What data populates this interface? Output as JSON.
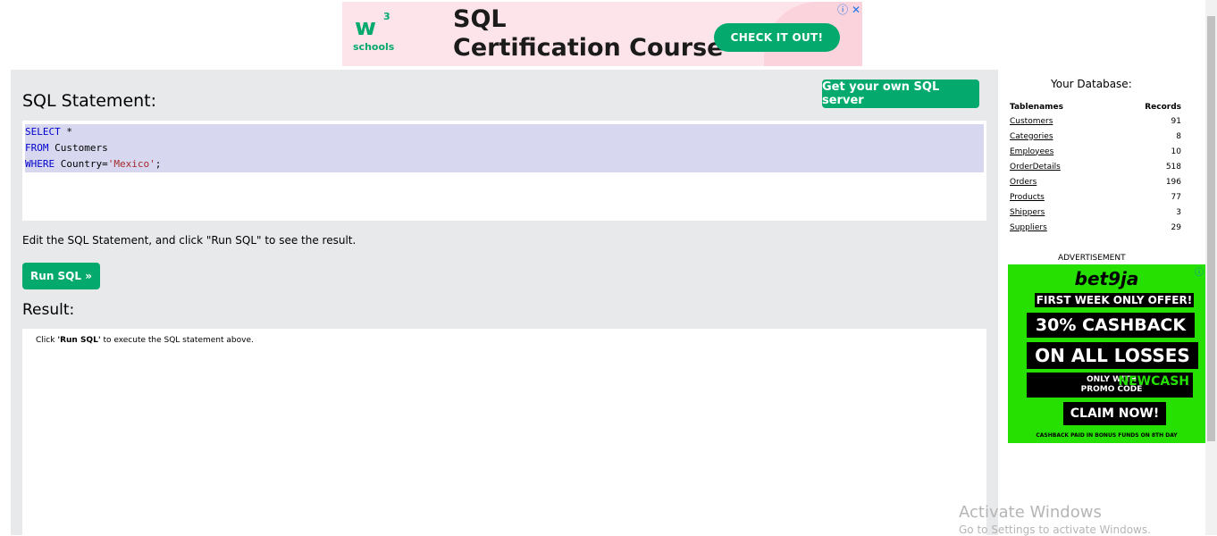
{
  "top_ad": {
    "logo_mark": "w",
    "logo_sup": "3",
    "logo_text": "schools",
    "title_line1": "SQL",
    "title_line2": "Certification Course",
    "cta": "CHECK IT OUT!",
    "icons": "ⓘ ✕"
  },
  "editor": {
    "heading": "SQL Statement:",
    "own_server_button": "Get your own SQL server",
    "code_lines": [
      {
        "kw": "SELECT",
        "rest": " *",
        "str": "",
        "tail": ""
      },
      {
        "kw": "FROM",
        "rest": " Customers",
        "str": "",
        "tail": ""
      },
      {
        "kw": "WHERE",
        "rest": " Country=",
        "str": "'Mexico'",
        "tail": ";"
      }
    ],
    "instruction": "Edit the SQL Statement, and click \"Run SQL\" to see the result.",
    "run_button": "Run SQL »"
  },
  "result": {
    "heading": "Result:",
    "msg_before": "Click ",
    "msg_bold": "'Run SQL'",
    "msg_after": " to execute the SQL statement above."
  },
  "database": {
    "title": "Your Database:",
    "col_tables": "Tablenames",
    "col_records": "Records",
    "rows": [
      {
        "name": "Customers",
        "records": "91"
      },
      {
        "name": "Categories",
        "records": "8"
      },
      {
        "name": "Employees",
        "records": "10"
      },
      {
        "name": "OrderDetails",
        "records": "518"
      },
      {
        "name": "Orders",
        "records": "196"
      },
      {
        "name": "Products",
        "records": "77"
      },
      {
        "name": "Shippers",
        "records": "3"
      },
      {
        "name": "Suppliers",
        "records": "29"
      }
    ],
    "ad_label": "ADVERTISEMENT"
  },
  "side_ad": {
    "brand": "bet9ja",
    "line1": "FIRST WEEK ONLY OFFER!",
    "line2": "30% CASHBACK",
    "line3": "ON ALL LOSSES",
    "line4a": "ONLY WITH",
    "line4b": "PROMO CODE",
    "promo_code": "NEWCASH",
    "cta": "CLAIM NOW!",
    "fine_print": "CASHBACK PAID IN BONUS FUNDS ON 8TH DAY"
  },
  "watermark": {
    "line1": "Activate Windows",
    "line2": "Go to Settings to activate Windows."
  },
  "colors": {
    "accent_green": "#04aa6d",
    "panel_gray": "#e7e9eb",
    "code_highlight": "#d7d7f0",
    "keyword_blue": "#0000cd",
    "string_brown": "#a52a2a"
  }
}
